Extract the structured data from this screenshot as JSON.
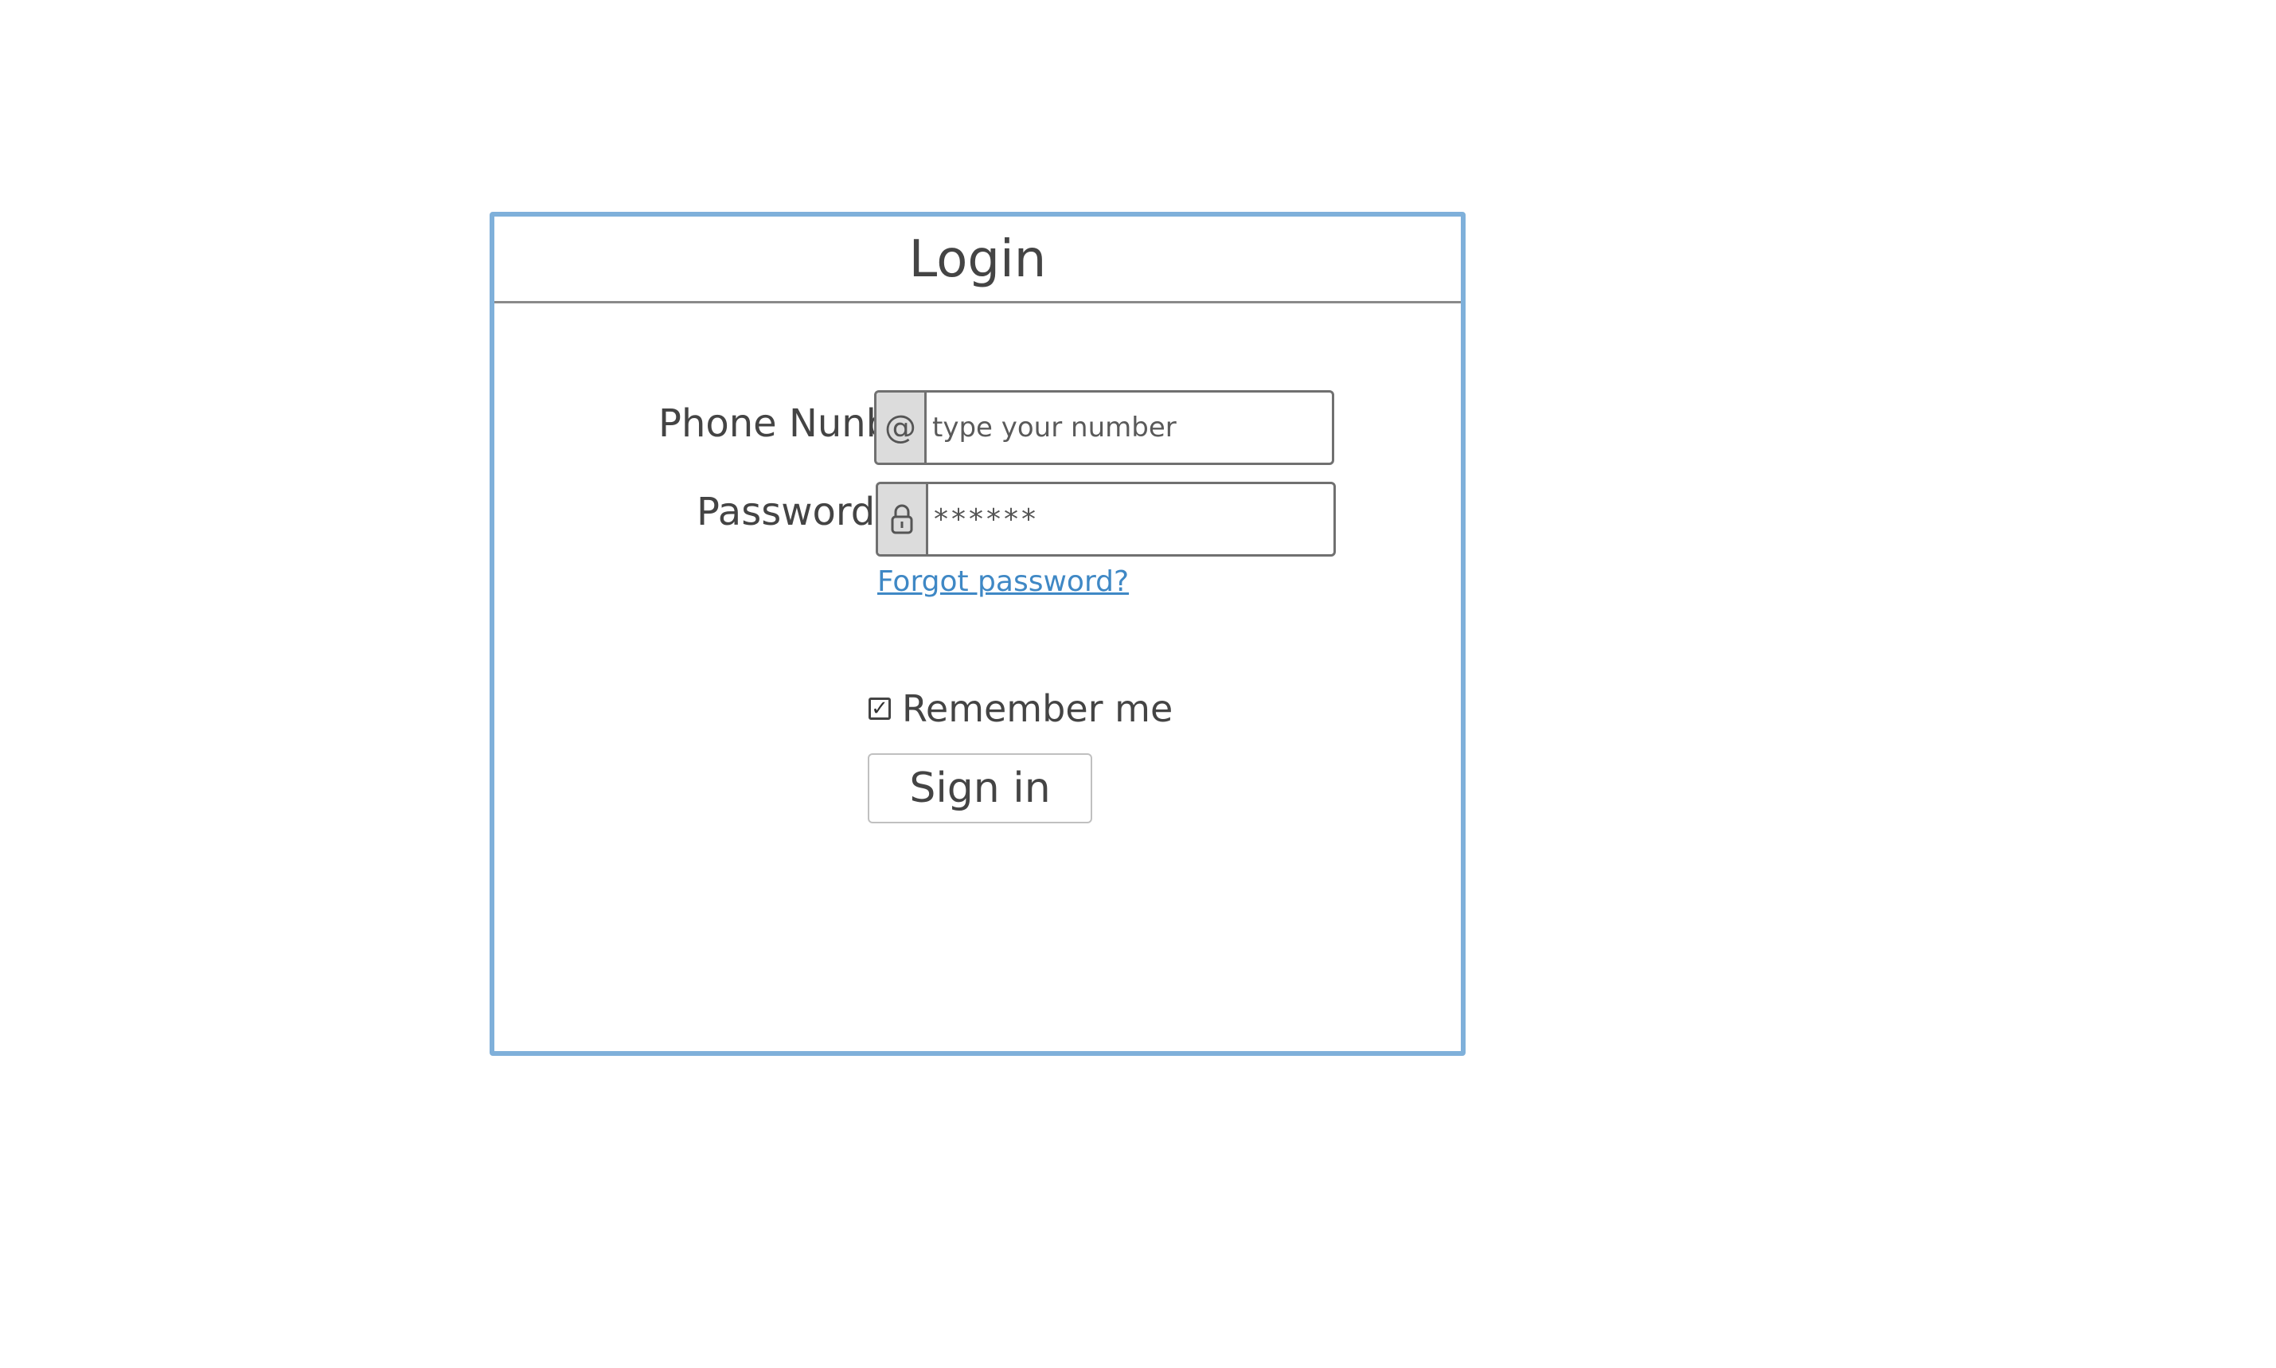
{
  "login": {
    "title": "Login",
    "phone": {
      "label": "Phone Nunber",
      "icon": "at-sign-icon",
      "icon_glyph": "@",
      "placeholder": "type your number",
      "value": ""
    },
    "password": {
      "label": "Password",
      "icon": "lock-icon",
      "icon_glyph": "🔒",
      "value": "******"
    },
    "forgot_password": "Forgot password?",
    "remember_me": {
      "label": "Remember me",
      "checked": true,
      "check_glyph": "✓"
    },
    "sign_in_label": "Sign in"
  },
  "colors": {
    "frame": "#7fb0da",
    "link": "#3f88c5",
    "addon_bg": "#dcdcdc"
  }
}
